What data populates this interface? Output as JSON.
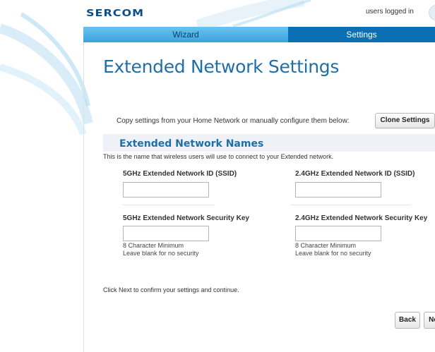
{
  "brand": {
    "logo_main": "SERCOM",
    "accent": "#1f6fa6",
    "tab_dark": "#0a6fb3",
    "tab_light": "#3aa4dd"
  },
  "header": {
    "users_text": "users logged in"
  },
  "tabs": [
    {
      "label": "Wizard",
      "active": false
    },
    {
      "label": "Settings",
      "active": true
    }
  ],
  "page_title": "Extended Network Settings",
  "clone": {
    "text": "Copy settings from your Home Network or manually configure them below:",
    "button_label": "Clone Settings"
  },
  "section": {
    "title": "Extended Network Names",
    "description": "This is the name that wireless users will use to connect to your Extended network."
  },
  "fields": {
    "ssid_5g": {
      "label": "5GHz Extended Network ID (SSID)",
      "value": ""
    },
    "ssid_24g": {
      "label": "2.4GHz Extended Network ID (SSID)",
      "value": ""
    },
    "key_5g": {
      "label": "5GHz Extended Network Security Key",
      "value": "",
      "hint1": "8 Character Minimum",
      "hint2": "Leave blank for no security"
    },
    "key_24g": {
      "label": "2.4GHz Extended Network Security Key",
      "value": "",
      "hint1": "8 Character Minimum",
      "hint2": "Leave blank for no security"
    }
  },
  "footer": {
    "text": "Click Next to confirm your settings and continue.",
    "back_label": "Back",
    "next_label": "Next"
  }
}
